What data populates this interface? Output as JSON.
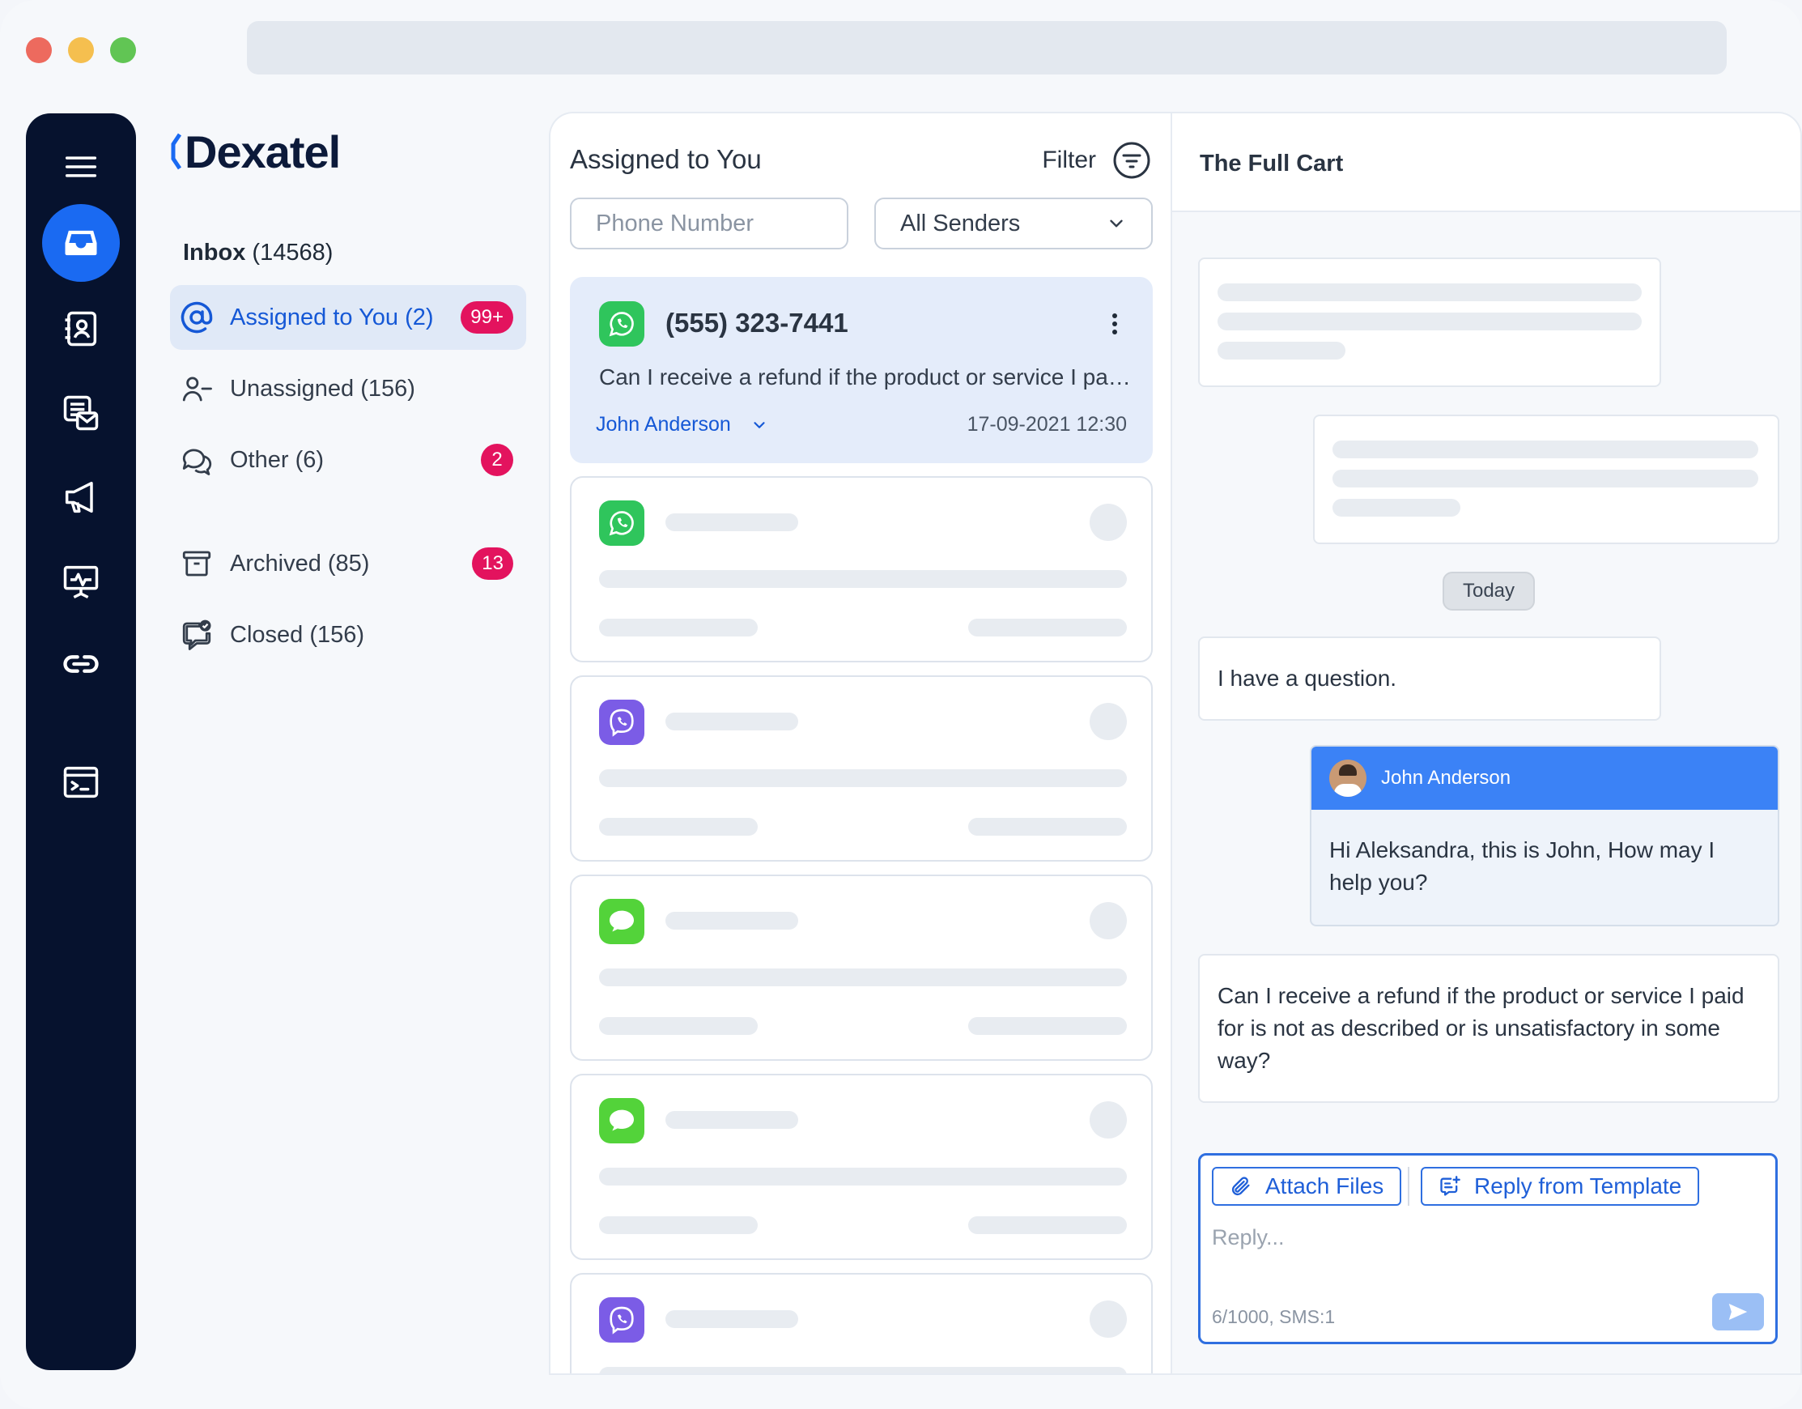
{
  "window": {
    "traffic_lights": [
      "close",
      "minimize",
      "zoom"
    ]
  },
  "rail": {
    "items": [
      {
        "icon": "menu-icon"
      },
      {
        "icon": "inbox-icon",
        "active": true
      },
      {
        "icon": "contacts-icon"
      },
      {
        "icon": "messages-icon"
      },
      {
        "icon": "megaphone-icon"
      },
      {
        "icon": "analytics-icon"
      },
      {
        "icon": "link-icon"
      },
      {
        "icon": "terminal-icon"
      }
    ]
  },
  "brand": {
    "name": "Dexatel",
    "color": "#0c1a3a",
    "accent": "#1a6af2"
  },
  "folders": {
    "inbox_label": "Inbox",
    "inbox_count": "(14568)",
    "items": [
      {
        "label": "Assigned to You (2)",
        "badge": "99+",
        "icon": "at-sign-icon"
      },
      {
        "label": "Unassigned (156)",
        "badge": "",
        "icon": "user-minus-icon"
      },
      {
        "label": "Other (6)",
        "badge": "2",
        "icon": "chat-bubbles-icon"
      },
      {
        "label": "Archived (85)",
        "badge": "13",
        "icon": "archive-icon"
      },
      {
        "label": "Closed (156)",
        "badge": "",
        "icon": "closed-chat-icon"
      }
    ]
  },
  "list": {
    "title": "Assigned to You",
    "filter_label": "Filter",
    "phone_placeholder": "Phone Number",
    "senders_value": "All Senders",
    "conversations": [
      {
        "channel": "whatsapp",
        "phone": "(555) 323-7441",
        "preview": "Can I receive a refund if the product or service I paid for is not as described or is unsatisfactory in some way?",
        "agent": "John Anderson",
        "date": "17-09-2021 12:30"
      },
      {
        "channel": "whatsapp"
      },
      {
        "channel": "viber"
      },
      {
        "channel": "imessage"
      },
      {
        "channel": "imessage"
      },
      {
        "channel": "viber"
      }
    ]
  },
  "chat": {
    "title": "The Full Cart",
    "day_separator": "Today",
    "messages": [
      {
        "from": "customer",
        "text": "I have a question."
      },
      {
        "from": "agent",
        "agent_name": "John Anderson",
        "text": "Hi Aleksandra, this is John, How may I help you?"
      },
      {
        "from": "customer",
        "text": "Can I receive a refund if the product or service I paid for is not as described or is unsatisfactory in some way?"
      }
    ],
    "composer": {
      "attach_label": "Attach Files",
      "template_label": "Reply from Template",
      "placeholder": "Reply...",
      "counter": "6/1000, SMS:1"
    }
  },
  "colors": {
    "whatsapp": "#2fc55c",
    "viber": "#7b5ce6",
    "imessage": "#53d33a",
    "badge": "#e3135e",
    "primary": "#1558d6"
  }
}
